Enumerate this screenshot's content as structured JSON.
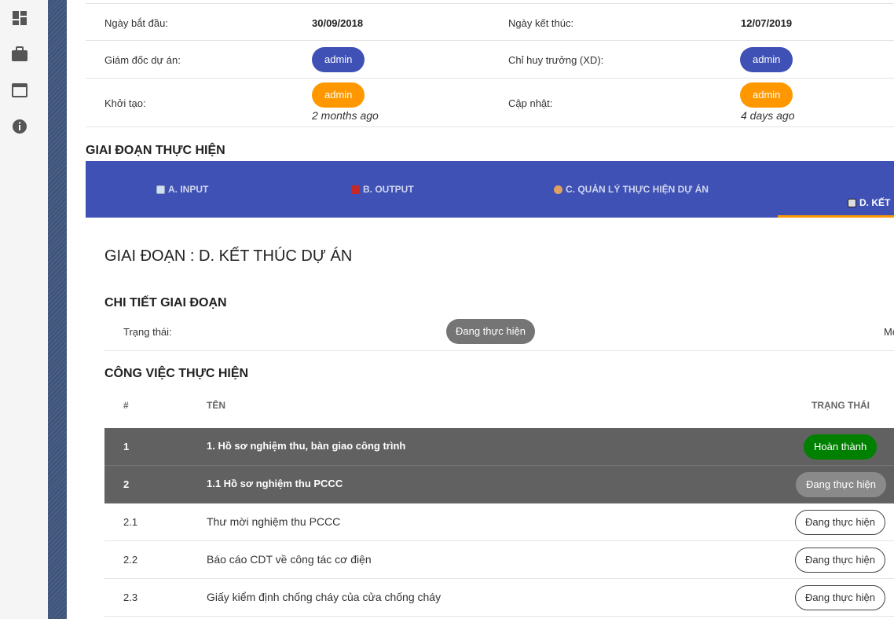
{
  "sidebar": {
    "icons": [
      "dashboard-icon",
      "briefcase-icon",
      "window-icon",
      "info-icon"
    ]
  },
  "project_info": {
    "start_label": "Ngày bắt đầu:",
    "start_value": "30/09/2018",
    "end_label": "Ngày kết thúc:",
    "end_value": "12/07/2019",
    "director_label": "Giám đốc dự án:",
    "director_value": "admin",
    "commander_label": "Chỉ huy trưởng (XD):",
    "commander_value": "admin",
    "created_label": "Khởi tạo:",
    "created_by": "admin",
    "created_ago": "2 months ago",
    "updated_label": "Cập nhật:",
    "updated_by": "admin",
    "updated_ago": "4 days ago"
  },
  "phases": {
    "title": "GIAI ĐOẠN THỰC HIỆN",
    "tabs": [
      {
        "label": "A. INPUT",
        "icon": "book-icon"
      },
      {
        "label": "B. OUTPUT",
        "icon": "red-book-icon"
      },
      {
        "label": "C. QUẢN LÝ THỰC HIỆN DỰ ÁN",
        "icon": "runner-icon"
      },
      {
        "label": "D. KẾT",
        "icon": "flag-icon",
        "active": true
      }
    ],
    "accent": "#3f51b5",
    "indicator_color": "#ff9800"
  },
  "phase_detail": {
    "heading": "GIAI ĐOẠN : D. KẾT THÚC DỰ ÁN",
    "detail_title": "CHI TIẾT GIAI ĐOẠN",
    "status_label": "Trạng thái:",
    "status_value": "Đang thực hiện",
    "right_cut_label": "Mô"
  },
  "tasks": {
    "title": "CÔNG VIỆC THỰC HIỆN",
    "columns": [
      "#",
      "TÊN",
      "TRẠNG THÁI"
    ],
    "rows": [
      {
        "num": "1",
        "name": "1. Hồ sơ nghiệm thu, bàn giao công trình",
        "status": "Hoàn thành"
      },
      {
        "num": "2",
        "name": "1.1 Hồ sơ nghiệm thu PCCC",
        "status": "Đang thực hiện"
      },
      {
        "num": "2.1",
        "name": "Thư mời nghiệm thu PCCC",
        "status": "Đang thực hiện"
      },
      {
        "num": "2.2",
        "name": "Báo cáo CDT về công tác cơ điện",
        "status": "Đang thực hiện"
      },
      {
        "num": "2.3",
        "name": "Giấy kiểm định chống cháy của cửa chống cháy",
        "status": "Đang thực hiện"
      }
    ]
  }
}
